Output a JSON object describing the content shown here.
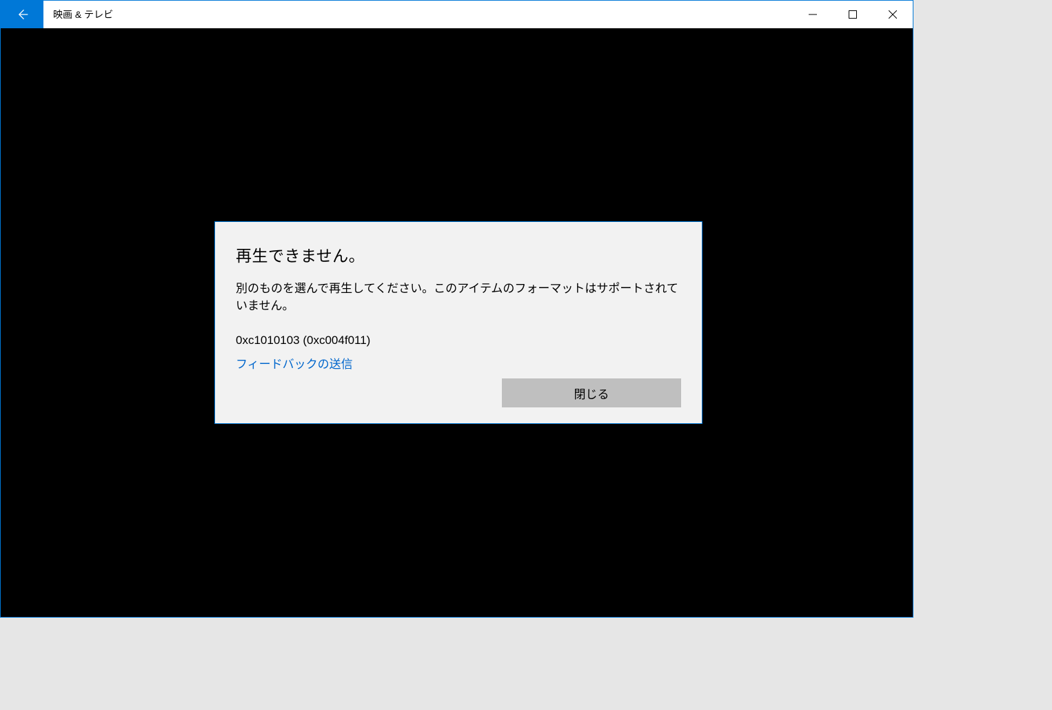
{
  "window": {
    "title": "映画 & テレビ"
  },
  "dialog": {
    "title": "再生できません。",
    "message": "別のものを選んで再生してください。このアイテムのフォーマットはサポートされていません。",
    "error_code": "0xc1010103 (0xc004f011)",
    "feedback_label": "フィードバックの送信",
    "close_label": "閉じる"
  }
}
